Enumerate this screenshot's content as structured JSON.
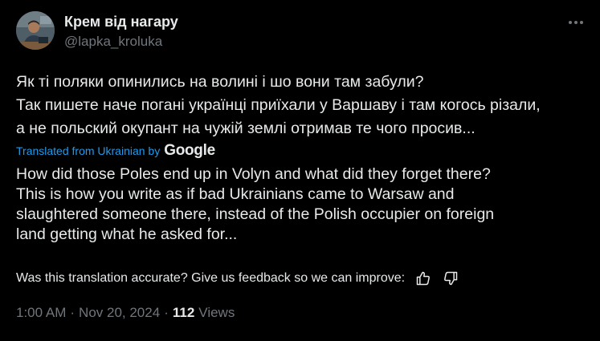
{
  "author": {
    "display_name": "Крем від нагару",
    "handle": "@lapka_kroluka",
    "avatar_icon": "avatar-person-at-desk-icon"
  },
  "menu": {
    "icon": "more-horizontal-icon"
  },
  "original_text": [
    "Як ті поляки опинились на волині і шо вони там забули?",
    "Так пишете наче погані українці приїхали у Варшаву і там когось різали,",
    "а не польский окупант на чужій землі отримав те чого просив..."
  ],
  "translation_meta": {
    "label": "Translated from Ukrainian by",
    "provider": "Google"
  },
  "translated_text": [
    "How did those Poles end up in Volyn and what did they forget there?",
    "This is how you write as if bad Ukrainians came to Warsaw and",
    "slaughtered someone there, instead of the Polish occupier on foreign",
    "land getting what he asked for..."
  ],
  "feedback": {
    "prompt": "Was this translation accurate? Give us feedback so we can improve:",
    "thumbs_up_icon": "thumbs-up-icon",
    "thumbs_down_icon": "thumbs-down-icon"
  },
  "meta": {
    "time": "1:00 AM",
    "separator": "·",
    "date": "Nov 20, 2024",
    "views_count": "112",
    "views_label": "Views"
  },
  "colors": {
    "background": "#000000",
    "text_primary": "#e7e9ea",
    "text_secondary": "#71767b",
    "link_accent": "#1d9bf0"
  }
}
